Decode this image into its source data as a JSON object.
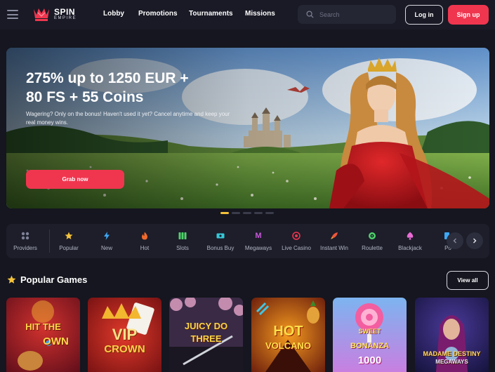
{
  "header": {
    "logo_line1": "SPIN",
    "logo_line2": "EMPIRE",
    "nav": [
      "Lobby",
      "Promotions",
      "Tournaments",
      "Missions"
    ],
    "search_placeholder": "Search",
    "login_label": "Log in",
    "signup_label": "Sign up"
  },
  "hero": {
    "title_line1": "275% up to 1250 EUR +",
    "title_line2": "80 FS + 55 Coins",
    "subtitle": "Wagering? Only on the bonus! Haven't used it yet? Cancel anytime and keep your real money wins.",
    "cta_label": "Grab now",
    "slide_count": 5,
    "active_slide": 0
  },
  "categories": [
    {
      "label": "Providers",
      "icon": "providers-grid-icon",
      "color": "#7f8296"
    },
    {
      "label": "Popular",
      "icon": "star-icon",
      "color": "#f5c33b"
    },
    {
      "label": "New",
      "icon": "lightning-icon",
      "color": "#3ea8f5"
    },
    {
      "label": "Hot",
      "icon": "fire-icon",
      "color": "#f06a2c"
    },
    {
      "label": "Slots",
      "icon": "slots-icon",
      "color": "#4fd26b"
    },
    {
      "label": "Bonus Buy",
      "icon": "bonus-buy-icon",
      "color": "#35c8d8"
    },
    {
      "label": "Megaways",
      "icon": "megaways-icon",
      "color": "#c65ad8"
    },
    {
      "label": "Live Casino",
      "icon": "live-casino-icon",
      "color": "#f0364f"
    },
    {
      "label": "Instant Win",
      "icon": "rocket-icon",
      "color": "#f0553a"
    },
    {
      "label": "Roulette",
      "icon": "roulette-icon",
      "color": "#4fd26b"
    },
    {
      "label": "Blackjack",
      "icon": "spade-icon",
      "color": "#e96bd4"
    },
    {
      "label": "Po",
      "icon": "poker-icon",
      "color": "#3ea8f5"
    }
  ],
  "popular": {
    "title": "Popular Games",
    "view_all_label": "View all",
    "games": [
      {
        "title_line1": "HIT THE",
        "title_line2": "OWN",
        "bg": "#8a1a2a"
      },
      {
        "title_line1": "VIP",
        "title_line2": "CROWN",
        "bg": "#a4161c"
      },
      {
        "title_line1": "JUICY DO",
        "title_line2": "THREE",
        "bg": "#3a2a46"
      },
      {
        "title_line1": "HOT",
        "title_line2": "VOLCANO",
        "bg": "#6a1512"
      },
      {
        "title_line1": "SWEET",
        "title_line2": "BONANZA",
        "title_line3": "1000",
        "bg": "#9b6be0"
      },
      {
        "title_line1": "MADAME DESTINY",
        "title_line2": "MEGAWAYS",
        "bg": "#2a2a6e"
      }
    ]
  },
  "colors": {
    "accent": "#f0364f",
    "background": "#15161f",
    "star": "#f5c33b"
  }
}
